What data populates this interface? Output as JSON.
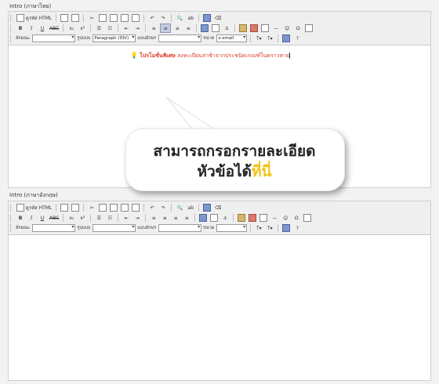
{
  "fields": {
    "thai_label": "Intro (ภาษาไทย)",
    "english_label": "Intro (ภาษาอังกฤษ)"
  },
  "toolbar": {
    "source_label": "ดูรหัส HTML",
    "bold": "B",
    "italic": "I",
    "underline": "U",
    "strike": "ABC",
    "sub": "x₂",
    "sup": "x²",
    "style_label": "ลักษณะ",
    "format_label": "รูปแบบ",
    "format_value": "Paragraph (DIV)",
    "font_label": "แบบอักษร",
    "size_label": "ขนาด",
    "size_value": "x-small"
  },
  "editor": {
    "highlight_text": "โปรโมชั่นพิเศษ",
    "body_text": "ลงทะเบียนล่าช้าจากประชนิดเกณฑ์ในคราวหาย"
  },
  "callout": {
    "line1": "สามารถกรอกรายละเอียด",
    "line2_main": "หัวข้อได้",
    "line2_accent": "ที่นี่",
    "accent_color": "#f0c419"
  }
}
